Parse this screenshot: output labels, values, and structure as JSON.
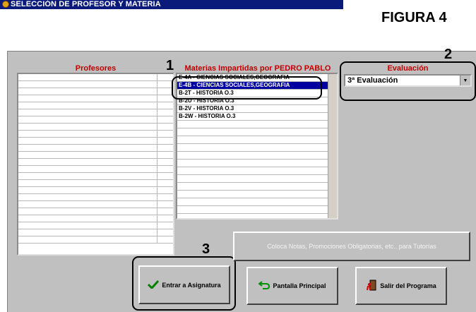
{
  "window": {
    "title": "SELECCIÓN DE PROFESOR Y MATERIA",
    "title_icon": "app-icon"
  },
  "figure_label": "FIGURA 4",
  "profesores": {
    "header": "Profesores",
    "rows": 24
  },
  "materias": {
    "header": "Materias Impartidas por PEDRO PABLO",
    "items": [
      {
        "text": "E-4A - CIENCIAS SOCIALES,GEOGRAFIA",
        "selected": false
      },
      {
        "text": "E-4B - CIENCIAS SOCIALES,GEOGRAFIA",
        "selected": true
      },
      {
        "text": "B-2T - HISTORIA O.3",
        "selected": false
      },
      {
        "text": "B-2U - HISTORIA O.3",
        "selected": false
      },
      {
        "text": "B-2V - HISTORIA O.3",
        "selected": false
      },
      {
        "text": "B-2W - HISTORIA O.3",
        "selected": false
      }
    ],
    "empty_rows": 13
  },
  "evaluacion": {
    "header": "Evaluación",
    "value": "3ª Evaluación",
    "arrow_icon": "dropdown-arrow-icon"
  },
  "callouts": [
    "1",
    "2",
    "3"
  ],
  "buttons": {
    "tutorias": "Coloca Notas, Promociones Obligatorias, etc.. para Tutorías",
    "entrar": {
      "label": "Entrar a Asignatura",
      "icon": "checkmark-icon"
    },
    "pantalla": {
      "label": "Pantalla Principal",
      "icon": "return-arrow-icon"
    },
    "salir": {
      "label": "Salir del Programa",
      "icon": "exit-door-icon"
    }
  },
  "colors": {
    "titlebar": "#0a1a7a",
    "header_text": "#c00000",
    "selection": "#0000a0",
    "panel": "#c0c0c0"
  }
}
